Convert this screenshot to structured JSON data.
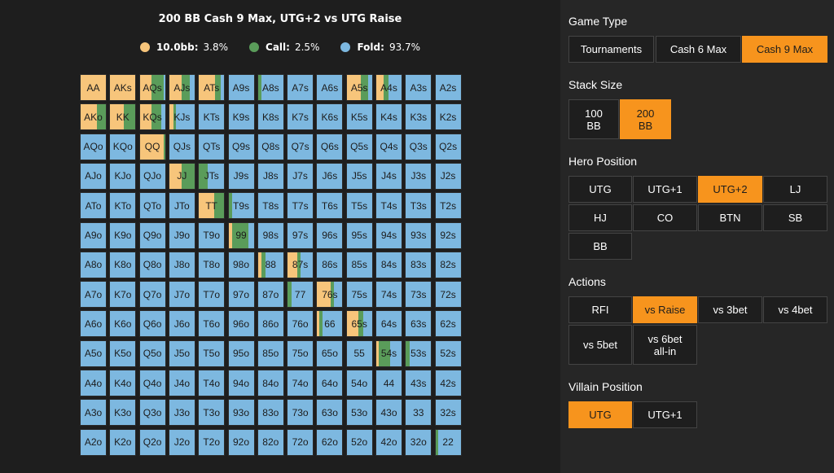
{
  "title": "200 BB Cash 9 Max, UTG+2 vs UTG Raise",
  "legend": [
    {
      "label": "10.0bb:",
      "value": "3.8%",
      "color": "#f7c57b"
    },
    {
      "label": "Call:",
      "value": "2.5%",
      "color": "#5a9c5a"
    },
    {
      "label": "Fold:",
      "value": "93.7%",
      "color": "#7db8e0"
    }
  ],
  "colors": {
    "raise": "#f7c57b",
    "call": "#5a9c5a",
    "fold": "#7db8e0"
  },
  "chart_data": {
    "type": "heatmap",
    "rows": [
      [
        "AA",
        "AKs",
        "AQs",
        "AJs",
        "ATs",
        "A9s",
        "A8s",
        "A7s",
        "A6s",
        "A5s",
        "A4s",
        "A3s",
        "A2s"
      ],
      [
        "AKo",
        "KK",
        "KQs",
        "KJs",
        "KTs",
        "K9s",
        "K8s",
        "K7s",
        "K6s",
        "K5s",
        "K4s",
        "K3s",
        "K2s"
      ],
      [
        "AQo",
        "KQo",
        "QQ",
        "QJs",
        "QTs",
        "Q9s",
        "Q8s",
        "Q7s",
        "Q6s",
        "Q5s",
        "Q4s",
        "Q3s",
        "Q2s"
      ],
      [
        "AJo",
        "KJo",
        "QJo",
        "JJ",
        "JTs",
        "J9s",
        "J8s",
        "J7s",
        "J6s",
        "J5s",
        "J4s",
        "J3s",
        "J2s"
      ],
      [
        "ATo",
        "KTo",
        "QTo",
        "JTo",
        "TT",
        "T9s",
        "T8s",
        "T7s",
        "T6s",
        "T5s",
        "T4s",
        "T3s",
        "T2s"
      ],
      [
        "A9o",
        "K9o",
        "Q9o",
        "J9o",
        "T9o",
        "99",
        "98s",
        "97s",
        "96s",
        "95s",
        "94s",
        "93s",
        "92s"
      ],
      [
        "A8o",
        "K8o",
        "Q8o",
        "J8o",
        "T8o",
        "98o",
        "88",
        "87s",
        "86s",
        "85s",
        "84s",
        "83s",
        "82s"
      ],
      [
        "A7o",
        "K7o",
        "Q7o",
        "J7o",
        "T7o",
        "97o",
        "87o",
        "77",
        "76s",
        "75s",
        "74s",
        "73s",
        "72s"
      ],
      [
        "A6o",
        "K6o",
        "Q6o",
        "J6o",
        "T6o",
        "96o",
        "86o",
        "76o",
        "66",
        "65s",
        "64s",
        "63s",
        "62s"
      ],
      [
        "A5o",
        "K5o",
        "Q5o",
        "J5o",
        "T5o",
        "95o",
        "85o",
        "75o",
        "65o",
        "55",
        "54s",
        "53s",
        "52s"
      ],
      [
        "A4o",
        "K4o",
        "Q4o",
        "J4o",
        "T4o",
        "94o",
        "84o",
        "74o",
        "64o",
        "54o",
        "44",
        "43s",
        "42s"
      ],
      [
        "A3o",
        "K3o",
        "Q3o",
        "J3o",
        "T3o",
        "93o",
        "83o",
        "73o",
        "63o",
        "53o",
        "43o",
        "33",
        "32s"
      ],
      [
        "A2o",
        "K2o",
        "Q2o",
        "J2o",
        "T2o",
        "92o",
        "82o",
        "72o",
        "62o",
        "52o",
        "42o",
        "32o",
        "22"
      ]
    ],
    "mix": {
      "AA": [
        1.0,
        0.0
      ],
      "AKs": [
        1.0,
        0.0
      ],
      "AQs": [
        0.45,
        0.5
      ],
      "AJs": [
        0.5,
        0.3
      ],
      "ATs": [
        0.65,
        0.2
      ],
      "A8s": [
        0.0,
        0.15
      ],
      "A5s": [
        0.55,
        0.3
      ],
      "A4s": [
        0.3,
        0.2
      ],
      "AKo": [
        0.65,
        0.35
      ],
      "KK": [
        0.55,
        0.45
      ],
      "KQs": [
        0.45,
        0.4
      ],
      "KJs": [
        0.15,
        0.1
      ],
      "QQ": [
        0.95,
        0.05
      ],
      "JJ": [
        0.5,
        0.5
      ],
      "JTs": [
        0.0,
        0.35
      ],
      "TT": [
        0.6,
        0.4
      ],
      "T9s": [
        0.0,
        0.15
      ],
      "99": [
        0.15,
        0.65
      ],
      "88": [
        0.15,
        0.15
      ],
      "87s": [
        0.4,
        0.1
      ],
      "77": [
        0.0,
        0.15
      ],
      "76s": [
        0.55,
        0.1
      ],
      "66": [
        0.1,
        0.1
      ],
      "65s": [
        0.45,
        0.2
      ],
      "54s": [
        0.1,
        0.45
      ],
      "53s": [
        0.0,
        0.15
      ],
      "22": [
        0.0,
        0.1
      ]
    }
  },
  "panel": {
    "game_type": {
      "label": "Game Type",
      "options": [
        "Tournaments",
        "Cash 6 Max",
        "Cash 9 Max"
      ],
      "selected": "Cash 9 Max"
    },
    "stack_size": {
      "label": "Stack Size",
      "options": [
        "100\nBB",
        "200\nBB"
      ],
      "selected": "200\nBB"
    },
    "hero_position": {
      "label": "Hero Position",
      "options": [
        "UTG",
        "UTG+1",
        "UTG+2",
        "LJ",
        "HJ",
        "CO",
        "BTN",
        "SB",
        "BB"
      ],
      "selected": "UTG+2"
    },
    "actions": {
      "label": "Actions",
      "options": [
        "RFI",
        "vs Raise",
        "vs 3bet",
        "vs 4bet",
        "vs 5bet",
        "vs 6bet\nall-in"
      ],
      "selected": "vs Raise"
    },
    "villain_position": {
      "label": "Villain Position",
      "options": [
        "UTG",
        "UTG+1"
      ],
      "selected": "UTG"
    }
  }
}
